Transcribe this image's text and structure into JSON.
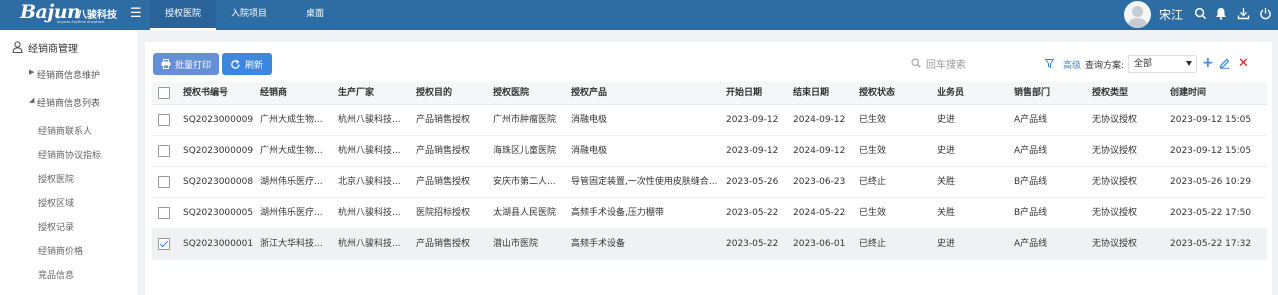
{
  "app": {
    "brand": "Bajun",
    "brand_cn": "八骏科技",
    "tagline": "Anyone Anytime Anywhere"
  },
  "topnav": {
    "tabs": [
      {
        "label": "授权医院",
        "active": true
      },
      {
        "label": "入院项目",
        "active": false
      },
      {
        "label": "桌面",
        "active": false
      }
    ]
  },
  "user": {
    "name": "宋江"
  },
  "sidebar": {
    "title": "经销商管理",
    "groups": [
      {
        "label": "经销商信息维护",
        "expanded": false
      },
      {
        "label": "经销商信息列表",
        "expanded": true
      }
    ],
    "items": [
      "经销商联系人",
      "经销商协议指标",
      "授权医院",
      "授权区域",
      "授权记录",
      "经销商价格",
      "竞品信息"
    ]
  },
  "toolbar": {
    "print_label": "批量打印",
    "refresh_label": "刷新",
    "search_placeholder": "回车搜索",
    "advanced_label": "高级",
    "scheme_label": "查询方案:",
    "scheme_value": "全部"
  },
  "table": {
    "columns": [
      "授权书编号",
      "经销商",
      "生产厂家",
      "授权目的",
      "授权医院",
      "授权产品",
      "开始日期",
      "结束日期",
      "授权状态",
      "业务员",
      "销售部门",
      "授权类型",
      "创建时间"
    ],
    "rows": [
      {
        "checked": false,
        "cells": [
          "SQ2023000009",
          "广州大成生物...",
          "杭州八骏科技...",
          "产品销售授权",
          "广州市肿瘤医院",
          "消融电极",
          "2023-09-12",
          "2024-09-12",
          "已生效",
          "史进",
          "A产品线",
          "无协议授权",
          "2023-09-12 15:05"
        ]
      },
      {
        "checked": false,
        "cells": [
          "SQ2023000009",
          "广州大成生物...",
          "杭州八骏科技...",
          "产品销售授权",
          "海珠区儿童医院",
          "消融电极",
          "2023-09-12",
          "2024-09-12",
          "已生效",
          "史进",
          "A产品线",
          "无协议授权",
          "2023-09-12 15:05"
        ]
      },
      {
        "checked": false,
        "cells": [
          "SQ2023000008",
          "湖州伟乐医疗...",
          "北京八骏科技...",
          "产品销售授权",
          "安庆市第二人...",
          "导管固定装置,一次性使用皮肤缝合...",
          "2023-05-26",
          "2023-06-23",
          "已终止",
          "关胜",
          "B产品线",
          "无协议授权",
          "2023-05-26 10:29"
        ]
      },
      {
        "checked": false,
        "cells": [
          "SQ2023000005",
          "湖州伟乐医疗...",
          "杭州八骏科技...",
          "医院招标授权",
          "太湖县人民医院",
          "高频手术设备,压力棚带",
          "2023-05-22",
          "2024-05-22",
          "已生效",
          "关胜",
          "B产品线",
          "无协议授权",
          "2023-05-22 17:50"
        ]
      },
      {
        "checked": true,
        "cells": [
          "SQ2023000001",
          "浙江大华科技...",
          "杭州八骏科技...",
          "产品销售授权",
          "潜山市医院",
          "高频手术设备",
          "2023-05-22",
          "2023-06-01",
          "已终止",
          "史进",
          "A产品线",
          "无协议授权",
          "2023-05-22 17:32"
        ]
      }
    ]
  }
}
